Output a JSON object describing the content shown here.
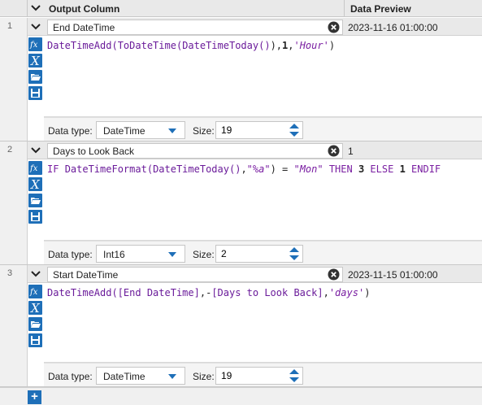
{
  "header": {
    "output_column": "Output Column",
    "data_preview": "Data Preview"
  },
  "labels": {
    "data_type": "Data type:",
    "size": "Size:"
  },
  "add_button": "+",
  "rows": [
    {
      "number": "1",
      "name": "End DateTime",
      "preview": "2023-11-16 01:00:00",
      "data_type": "DateTime",
      "size": "19",
      "expression": [
        {
          "t": "fn",
          "v": "DateTimeAdd("
        },
        {
          "t": "fn",
          "v": "ToDateTime("
        },
        {
          "t": "fn",
          "v": "DateTimeToday()"
        },
        {
          "t": "p",
          "v": "),"
        },
        {
          "t": "num",
          "v": "1"
        },
        {
          "t": "p",
          "v": ","
        },
        {
          "t": "str",
          "v": "'Hour'"
        },
        {
          "t": "p",
          "v": ")"
        }
      ]
    },
    {
      "number": "2",
      "name": "Days to Look Back",
      "preview": "1",
      "data_type": "Int16",
      "size": "2",
      "expression": [
        {
          "t": "kw",
          "v": "IF "
        },
        {
          "t": "fn",
          "v": "DateTimeFormat("
        },
        {
          "t": "fn",
          "v": "DateTimeToday()"
        },
        {
          "t": "p",
          "v": ","
        },
        {
          "t": "str",
          "v": "\"%a\""
        },
        {
          "t": "p",
          "v": ") = "
        },
        {
          "t": "str",
          "v": "\"Mon\""
        },
        {
          "t": "kw",
          "v": " THEN "
        },
        {
          "t": "num",
          "v": "3"
        },
        {
          "t": "kw",
          "v": " ELSE "
        },
        {
          "t": "num",
          "v": "1"
        },
        {
          "t": "kw",
          "v": " ENDIF"
        }
      ]
    },
    {
      "number": "3",
      "name": "Start DateTime",
      "preview": "2023-11-15 01:00:00",
      "data_type": "DateTime",
      "size": "19",
      "expression": [
        {
          "t": "fn",
          "v": "DateTimeAdd("
        },
        {
          "t": "field",
          "v": "[End DateTime]"
        },
        {
          "t": "p",
          "v": ",-"
        },
        {
          "t": "field",
          "v": "[Days to Look Back]"
        },
        {
          "t": "p",
          "v": ","
        },
        {
          "t": "str",
          "v": "'days'"
        },
        {
          "t": "p",
          "v": ")"
        }
      ]
    }
  ],
  "icons": {
    "row_toolbar": [
      "function-icon",
      "variable-icon",
      "folder-open-icon",
      "save-icon"
    ],
    "accent": "#1e6fb8"
  }
}
